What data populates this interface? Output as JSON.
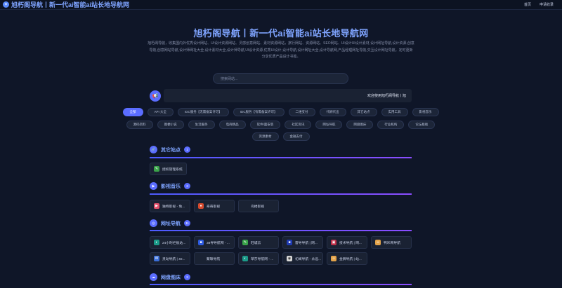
{
  "header": {
    "title": "旭朽阁导航丨新一代ai智能ai站长地导航网",
    "links": [
      "首页",
      "申请收录"
    ]
  },
  "hero": {
    "title": "旭朽阁导航丨新一代ai智能ai站长地导航网",
    "description": "旭朽阁导航，收集国内外优秀设计网站、UI设计资源网站、灵感创意网站、素材资源网站，旅行网站、资源网站、SEO网站、UI设计UI设计素材,设计网址导航,设计资源,创意导航,创意网站导航,设计师网址大全,设计素材大全,设计师导航,UI设计资源,优秀UI设计,设计导航,设计网址大全,设计导航网,产品经理网址导航,交互设计网址导航。定时更新分享优质产品设计书签。"
  },
  "search": {
    "placeholder": "搜索网站..."
  },
  "notice": {
    "text": "欢迎使用旭朽阁导航丨旭"
  },
  "categories": {
    "row1": [
      "全部",
      "API 大全",
      "IDC服务【无需备案许可】",
      "IDC服务【有需备案许可】",
      "二维支付",
      "代刷代出",
      "其它站点",
      "实用工具",
      "影视音乐"
    ],
    "row2": [
      "源码资料",
      "图梗小说",
      "生活服务",
      "电商精品",
      "软件/面安装",
      "社区资讯",
      "网址导航",
      "网盘图床",
      "行业机构",
      "论坛板板"
    ],
    "row3": [
      "资源素材",
      "金融支付"
    ]
  },
  "sections": {
    "other": {
      "title": "其它站点",
      "count": "1",
      "items": [
        "授权管理系统"
      ]
    },
    "video": {
      "title": "影视音乐",
      "count": "3",
      "items": [
        "独特影视 - 免...",
        "奇奇影视",
        "鸟楼影视"
      ]
    },
    "nav": {
      "title": "网址导航",
      "count": "11",
      "items": [
        "24小时栏板站...",
        "38导导航网 - ...",
        "旺城云",
        "雷导导航 | 网...",
        "技术导航 | 网...",
        "鸭咔网导航",
        "灵动导航 | 40...",
        "聚联导航",
        "草莎导航网 - ...",
        "初闻导航 - 永远...",
        "金狮导航 | 站..."
      ]
    },
    "storage": {
      "title": "网盘图床",
      "count": "2"
    }
  },
  "colors": {
    "accent": "#5b6dff",
    "title": "#7fa4ff",
    "background": "#0f1628"
  },
  "icons": {
    "notice": "megaphone-icon",
    "logo": "compass-icon"
  }
}
